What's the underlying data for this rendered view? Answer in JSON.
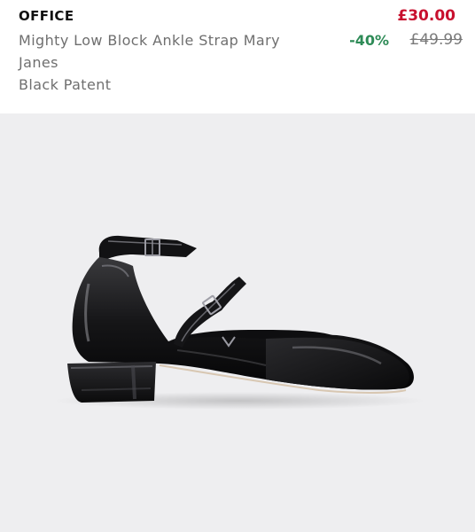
{
  "product": {
    "brand": "OFFICE",
    "name": "Mighty Low Block Ankle Strap Mary Janes",
    "variant": "Black Patent"
  },
  "pricing": {
    "current": "£30.00",
    "discount": "-40%",
    "original": "£49.99"
  },
  "colors": {
    "price": "#c8102e",
    "discount": "#2e8b57",
    "image_background": "#eeeef0"
  },
  "image": {
    "subject": "shoe-image"
  }
}
